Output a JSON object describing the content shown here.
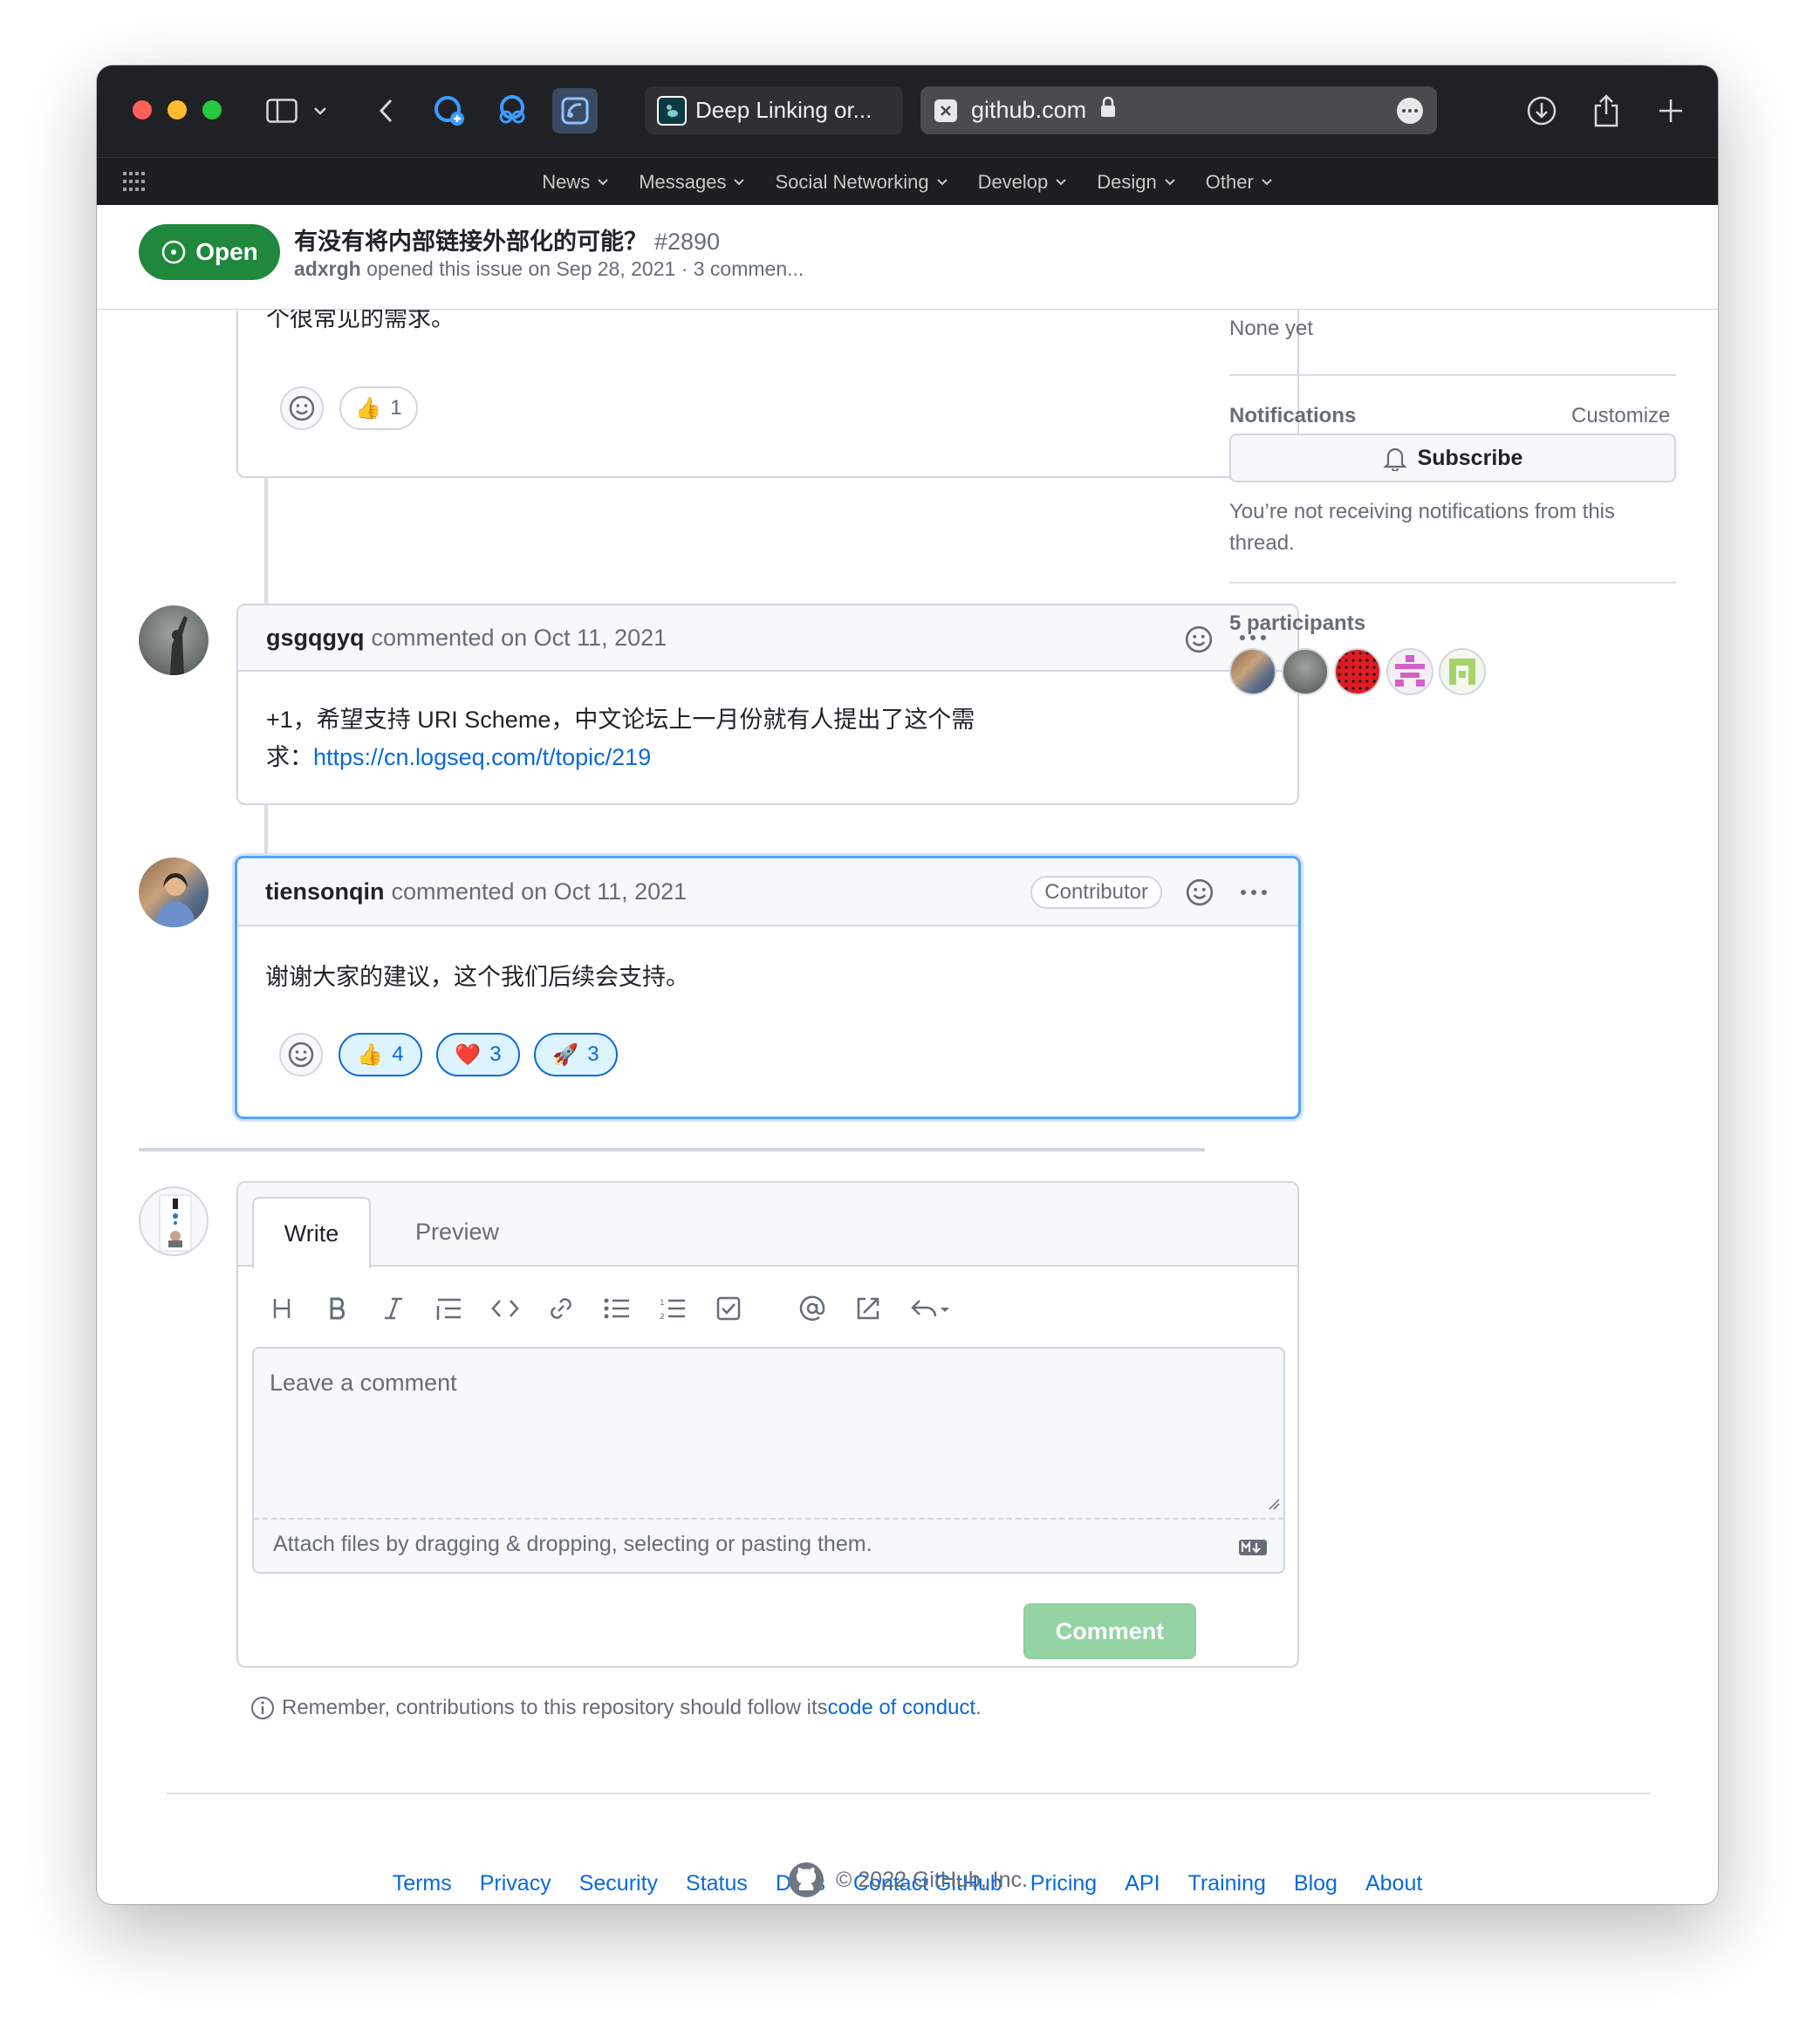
{
  "browser": {
    "active_tab_title": "Deep Linking or...",
    "address": "github.com",
    "favorites": [
      "News",
      "Messages",
      "Social Networking",
      "Develop",
      "Design",
      "Other"
    ]
  },
  "issue": {
    "state": "Open",
    "title": "有没有将内部链接外部化的可能？",
    "number": "#2890",
    "author": "adxrgh",
    "meta_rest": "opened this issue on Sep 28, 2021 · 3 commen..."
  },
  "comments": {
    "first_partial": {
      "body_tail": "个很常见的需求。",
      "reactions": [
        {
          "emoji": "👍",
          "count": "1"
        }
      ]
    },
    "second": {
      "author": "gsgqgyq",
      "action": "commented on Oct 11, 2021",
      "body_line1": "+1，希望支持 URI Scheme，中文论坛上一月份就有人提出了这个需",
      "body_line2_prefix": "求：",
      "link": "https://cn.logseq.com/t/topic/219"
    },
    "third": {
      "author": "tiensonqin",
      "action": "commented on Oct 11, 2021",
      "badge": "Contributor",
      "body": "谢谢大家的建议，这个我们后续会支持。",
      "reactions": [
        {
          "emoji": "👍",
          "count": "4"
        },
        {
          "emoji": "❤️",
          "count": "3"
        },
        {
          "emoji": "🚀",
          "count": "3"
        }
      ]
    }
  },
  "editor": {
    "tab_write": "Write",
    "tab_preview": "Preview",
    "placeholder": "Leave a comment",
    "attach_text": "Attach files by dragging & dropping, selecting or pasting them.",
    "submit_label": "Comment",
    "conduct_prefix": "Remember, contributions to this repository should follow its ",
    "conduct_link": "code of conduct",
    "conduct_suffix": "."
  },
  "sidebar": {
    "milestone_value": "None yet",
    "notifications_label": "Notifications",
    "customize_label": "Customize",
    "subscribe_label": "Subscribe",
    "notify_text_line1": "You’re not receiving notifications from this",
    "notify_text_line2": "thread.",
    "participants_label": "5 participants"
  },
  "footer": {
    "links": [
      "Terms",
      "Privacy",
      "Security",
      "Status",
      "Docs",
      "Contact GitHub",
      "Pricing",
      "API",
      "Training",
      "Blog",
      "About"
    ],
    "copyright": "© 2022 GitHub, Inc."
  },
  "colors": {
    "open_green": "#1f883d",
    "link_blue": "#0969da",
    "comment_button_disabled": "#94d3a2"
  }
}
